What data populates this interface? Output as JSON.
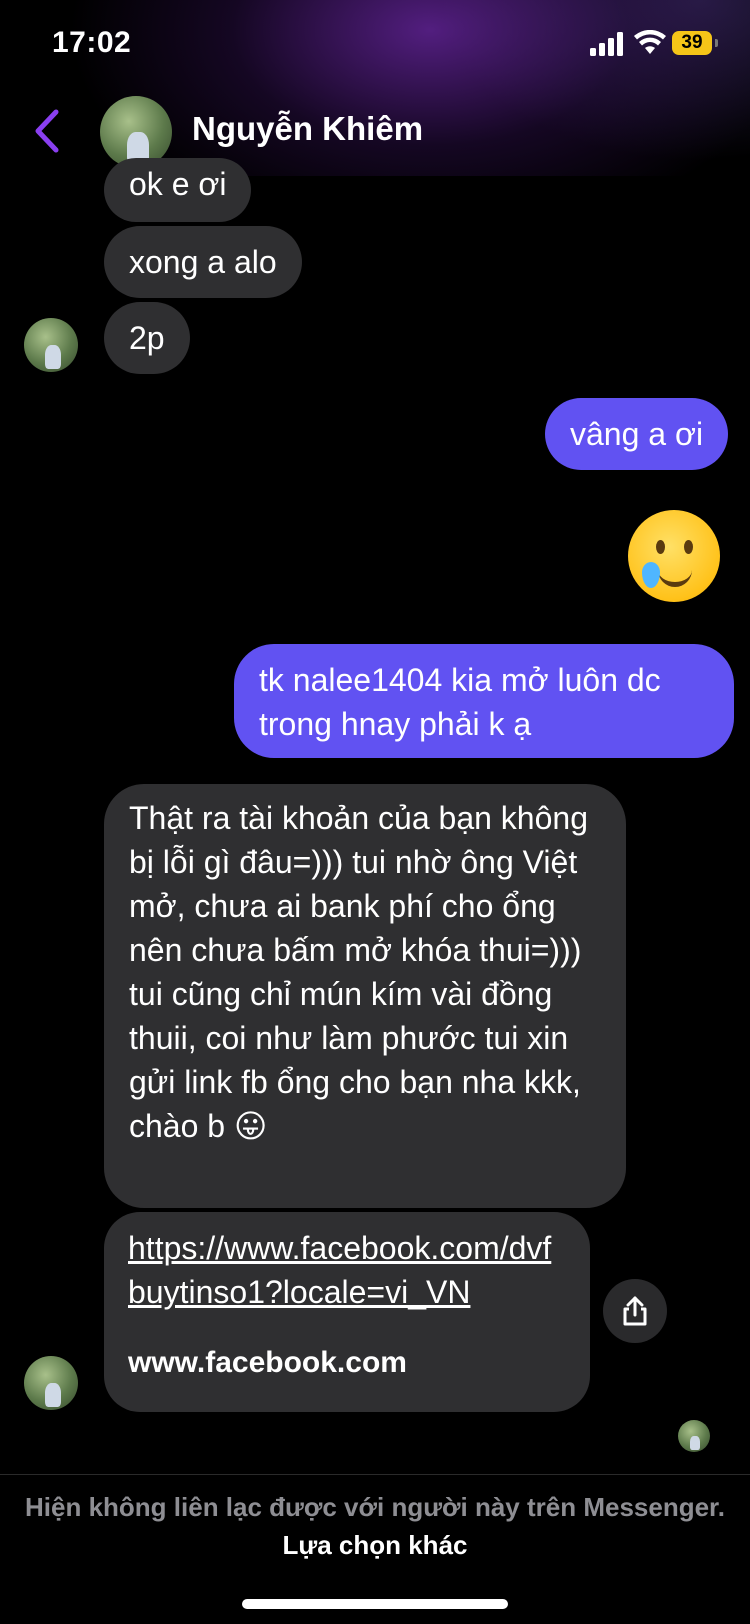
{
  "status": {
    "time": "17:02",
    "battery": "39"
  },
  "header": {
    "name": "Nguyễn Khiêm"
  },
  "messages": [
    {
      "from": "them",
      "text": "ok e ơi"
    },
    {
      "from": "them",
      "text": "xong a alo"
    },
    {
      "from": "them",
      "text": "2p"
    },
    {
      "from": "me",
      "text": "vâng a ơi"
    },
    {
      "from": "me",
      "emoji": "crying-smile-emoji"
    },
    {
      "from": "me",
      "text": "tk nalee1404 kia mở luôn dc trong hnay phải k ạ"
    },
    {
      "from": "them",
      "text": "Thật ra tài khoản của bạn không bị lỗi gì đâu=))) tui nhờ ông Việt mở, chưa ai bank phí cho ổng nên chưa bấm mở khóa thui=))) tui cũng chỉ mún kím vài đồng thuii, coi như làm phước tui xin gửi link fb ổng cho bạn nha kkk, chào b 😛"
    },
    {
      "from": "them",
      "link_url": "https://www.facebook.com/dvfbuytinso1?locale=vi_VN",
      "link_domain": "www.facebook.com"
    }
  ],
  "footer": {
    "notice": "Hiện không liên lạc được với người này trên Messenger.",
    "option": "Lựa chọn khác"
  },
  "colors": {
    "outgoing_bubble": "#6152f2",
    "incoming_bubble": "#2f2f31",
    "accent": "#8a3ff0"
  }
}
